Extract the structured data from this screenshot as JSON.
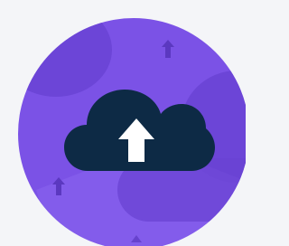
{
  "icon": {
    "name": "cloud-upload-icon",
    "decorations": [
      "upload-arrow-icon",
      "upload-arrow-icon"
    ]
  },
  "colors": {
    "page_background": "#f4f5f8",
    "circle_purple": "#7b52e6",
    "circle_purple_dark": "#6a43d3",
    "circle_purple_light": "#8a64ee",
    "cloud": "#0d2a45",
    "arrow": "#ffffff"
  }
}
